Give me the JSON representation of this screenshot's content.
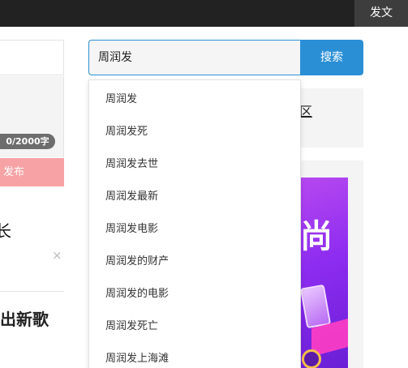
{
  "topbar": {
    "post_label": "发文"
  },
  "left": {
    "char_count": "0/2000字",
    "publish_label": "发布",
    "feed_title_1": "长",
    "close_symbol": "×",
    "feed_title_2": "出新歌"
  },
  "search": {
    "value": "周润发",
    "button_label": "搜索",
    "suggestions": [
      "周润发",
      "周润发死",
      "周润发去世",
      "周润发最新",
      "周润发电影",
      "周润发的财产",
      "周润发的电影",
      "周润发死亡",
      "周润发上海滩"
    ]
  },
  "right": {
    "zone_text": "区",
    "banner_glyph": "尚"
  },
  "colors": {
    "topbar": "#222222",
    "accent": "#2b8fd6",
    "publish": "#f7a3a6",
    "banner": "#8d2cf0"
  },
  "icons": [
    "close-icon"
  ]
}
